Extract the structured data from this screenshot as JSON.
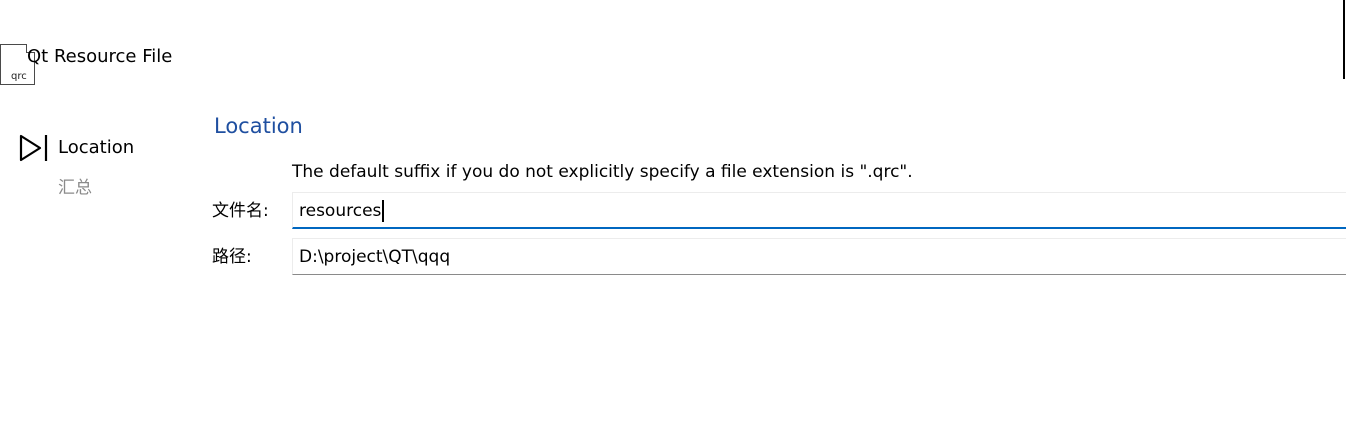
{
  "header": {
    "icon_text": "qrc",
    "title": "Qt Resource File"
  },
  "sidebar": {
    "steps": [
      {
        "label": "Location",
        "current": true
      },
      {
        "label": "汇总",
        "current": false
      }
    ]
  },
  "main": {
    "section_title": "Location",
    "hint": "The default suffix if you do not explicitly specify a file extension is \".qrc\".",
    "fields": {
      "name": {
        "label": "文件名:",
        "value": "resources"
      },
      "path": {
        "label": "路径:",
        "value": "D:\\project\\QT\\qqq"
      }
    }
  },
  "colors": {
    "accent": "#0067c0",
    "section_title": "#1f4fa0",
    "muted_text": "#8a8a8a"
  },
  "icons": {
    "file": "qrc-file-icon",
    "current_step": "play-arrow-icon"
  }
}
